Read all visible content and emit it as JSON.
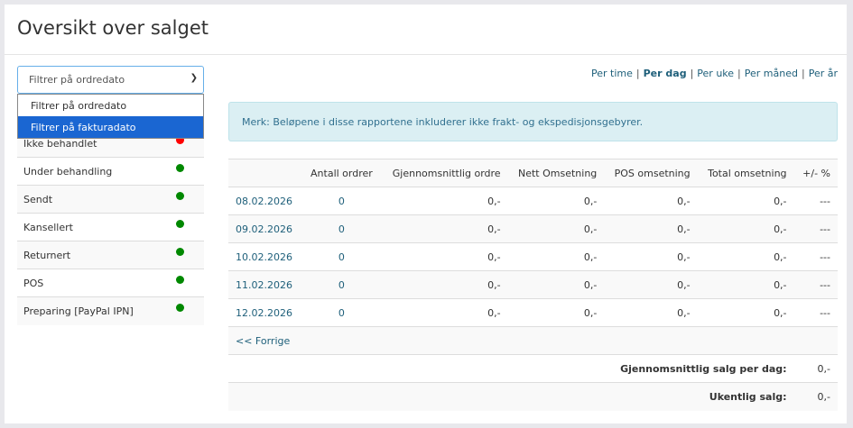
{
  "title": "Oversikt over salget",
  "filter": {
    "selected": "Filtrer på ordredato",
    "options": [
      "Filtrer på ordredato",
      "Filtrer på fakturadato"
    ]
  },
  "statuses": [
    {
      "label": "Ikke behandlet",
      "color": "#ff0000"
    },
    {
      "label": "Under behandling",
      "color": "#008000"
    },
    {
      "label": "Sendt",
      "color": "#008000"
    },
    {
      "label": "Kansellert",
      "color": "#008000"
    },
    {
      "label": "Returnert",
      "color": "#008000"
    },
    {
      "label": "POS",
      "color": "#008000"
    },
    {
      "label": "Preparing [PayPal IPN]",
      "color": "#008000"
    }
  ],
  "periods": [
    "Per time",
    "Per dag",
    "Per uke",
    "Per måned",
    "Per år"
  ],
  "note": "Merk: Beløpene i disse rapportene inkluderer ikke frakt- og ekspedisjonsgebyrer.",
  "table": {
    "headers": [
      "",
      "Antall ordrer",
      "Gjennomsnittlig ordre",
      "Nett Omsetning",
      "POS omsetning",
      "Total omsetning",
      "+/- %"
    ],
    "rows": [
      [
        "08.02.2026",
        "0",
        "0,-",
        "0,-",
        "0,-",
        "0,-",
        "---"
      ],
      [
        "09.02.2026",
        "0",
        "0,-",
        "0,-",
        "0,-",
        "0,-",
        "---"
      ],
      [
        "10.02.2026",
        "0",
        "0,-",
        "0,-",
        "0,-",
        "0,-",
        "---"
      ],
      [
        "11.02.2026",
        "0",
        "0,-",
        "0,-",
        "0,-",
        "0,-",
        "---"
      ],
      [
        "12.02.2026",
        "0",
        "0,-",
        "0,-",
        "0,-",
        "0,-",
        "---"
      ]
    ],
    "prev": "<< Forrige",
    "avg_label": "Gjennomsnittlig salg per dag:",
    "avg_value": "0,-",
    "week_label": "Ukentlig salg:",
    "week_value": "0,-"
  }
}
